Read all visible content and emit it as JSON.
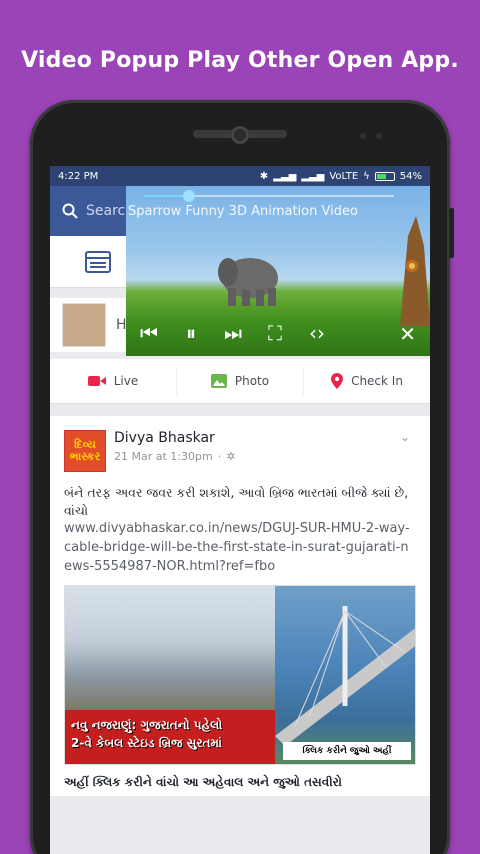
{
  "promo": {
    "title": "Video Popup Play Other Open App."
  },
  "status_bar": {
    "time": "4:22 PM",
    "network": "VoLTE",
    "battery": "54%",
    "battery_level": 0.54
  },
  "search": {
    "placeholder": "Search"
  },
  "video_popup": {
    "title": "Sparrow Funny 3D Animation Video",
    "progress": 0.18
  },
  "composer": {
    "hint": "H"
  },
  "actions": {
    "live": "Live",
    "photo": "Photo",
    "checkin": "Check In"
  },
  "post": {
    "page_name": "Divya Bhaskar",
    "page_logo": "દિવ્ય ભાસ્કર",
    "time": "21 Mar at 1:30pm",
    "body": "બંને તરફ અવર જવર કરી શકાશે, આવો બ્રિજ ભારતમાં બીજે ક્યાં છે, વાંચો",
    "link": "www.divyabhaskar.co.in/news/DGUJ-SUR-HMU-2-way-cable-bridge-will-be-the-first-state-in-surat-gujarati-news-5554987-NOR.html?ref=fbo",
    "image_banner_line1": "નવુ નજરાણું: ગુજરાતનો પહેલો",
    "image_banner_line2": "2-વે કેબલ સ્ટેઇડ બ્રિજ સુરતમાં",
    "image_button": "ક્લિક કરીને જુઓ અહીં",
    "caption": "અહીં ક્લિક કરીને વાંચો આ અહેવાલ અને જુઓ તસવીરો"
  },
  "colors": {
    "background": "#9b44b8",
    "facebook_blue": "#3b5998",
    "status_bar": "#2d4373"
  }
}
